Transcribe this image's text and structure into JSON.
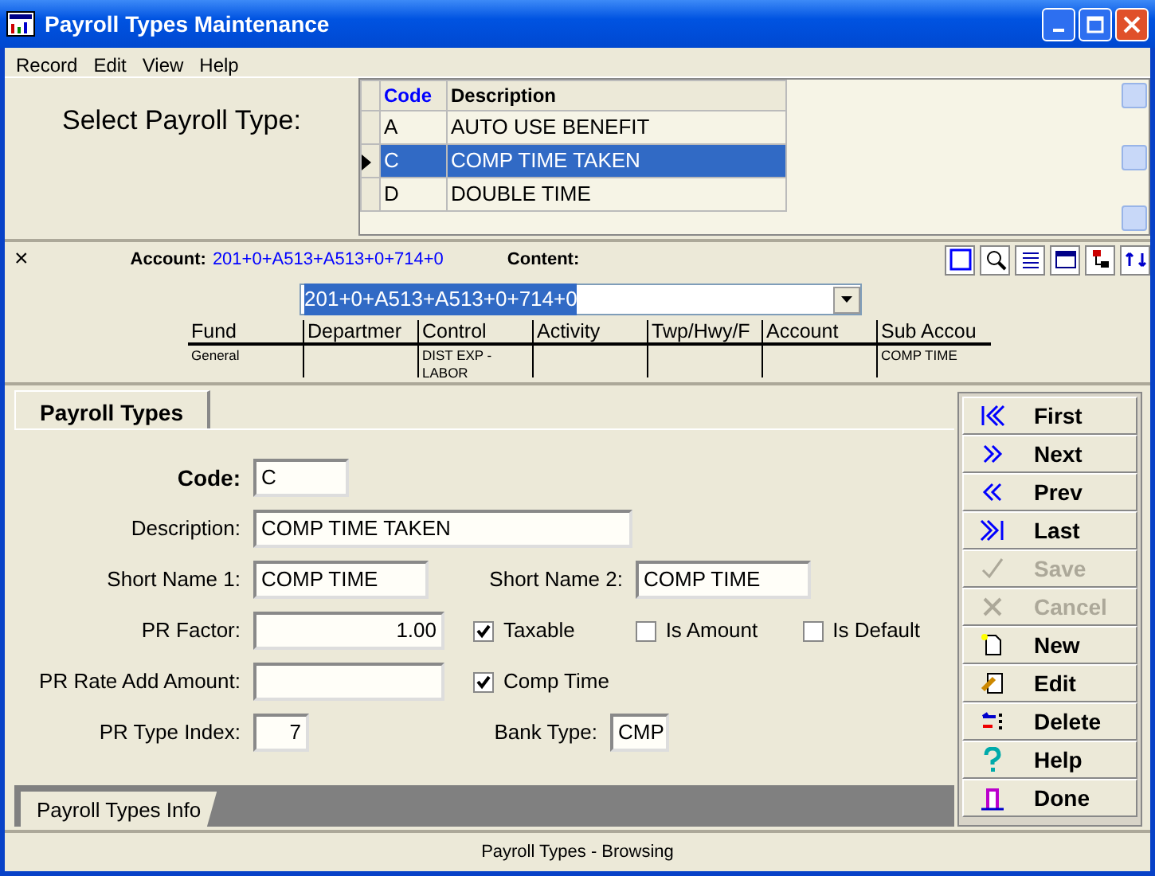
{
  "window": {
    "title": "Payroll Types Maintenance"
  },
  "menu": [
    {
      "label": "Record"
    },
    {
      "label": "Edit"
    },
    {
      "label": "View"
    },
    {
      "label": "Help"
    }
  ],
  "selector": {
    "label": "Select Payroll Type:",
    "columns": [
      {
        "label": "Code"
      },
      {
        "label": "Description"
      }
    ],
    "rows": [
      {
        "code": "A",
        "description": "AUTO USE BENEFIT",
        "selected": false
      },
      {
        "code": "C",
        "description": "COMP TIME TAKEN",
        "selected": true
      },
      {
        "code": "D",
        "description": "DOUBLE TIME",
        "selected": false
      }
    ]
  },
  "account_bar": {
    "close": "×",
    "account_label": "Account:",
    "account_value": "201+0+A513+A513+0+714+0",
    "content_label": "Content:"
  },
  "account_editor": {
    "value": "201+0+A513+A513+0+714+0",
    "segments": [
      {
        "heading": "Fund",
        "content": "General"
      },
      {
        "heading": "Departmer"
      },
      {
        "heading": "Control",
        "content": "DIST EXP - LABOR"
      },
      {
        "heading": "Activity"
      },
      {
        "heading": "Twp/Hwy/F"
      },
      {
        "heading": "Account"
      },
      {
        "heading": "Sub Accou",
        "content": "COMP TIME"
      }
    ]
  },
  "tabs": [
    {
      "label": "Payroll Types",
      "selected": true
    }
  ],
  "form": [
    [
      {
        "kind": "key",
        "label": "Code:",
        "value": "C"
      }
    ],
    [
      {
        "kind": "text",
        "label": "Description:",
        "value": "COMP TIME TAKEN"
      }
    ],
    [
      {
        "kind": "text",
        "label": "Short Name 1:",
        "value": "COMP TIME"
      },
      {
        "kind": "text",
        "label": "Short Name 2:",
        "value": "COMP TIME"
      }
    ],
    [
      {
        "kind": "number",
        "label": "PR Factor:",
        "value": "1.00"
      },
      {
        "kind": "checkbox",
        "label": "Taxable",
        "checked": true
      },
      {
        "kind": "checkbox",
        "label": "Is Amount",
        "checked": false
      },
      {
        "kind": "checkbox",
        "label": "Is Default",
        "checked": false
      }
    ],
    [
      {
        "kind": "number",
        "label": "PR Rate Add Amount:"
      },
      {
        "kind": "checkbox",
        "label": "Comp Time",
        "checked": true
      }
    ],
    [
      {
        "kind": "number",
        "label": "PR Type Index:",
        "value": "7"
      },
      {
        "kind": "text",
        "label": "Bank Type:",
        "value": "CMP"
      }
    ]
  ],
  "bottom_tabs": [
    {
      "label": "Payroll Types Info",
      "selected": true
    }
  ],
  "buttons": [
    {
      "label": "First",
      "disabled": false
    },
    {
      "label": "Next",
      "disabled": false
    },
    {
      "label": "Prev",
      "disabled": false
    },
    {
      "label": "Last",
      "disabled": false
    },
    {
      "label": "Save",
      "disabled": true
    },
    {
      "label": "Cancel",
      "disabled": true
    },
    {
      "label": "New",
      "disabled": false
    },
    {
      "label": "Edit",
      "disabled": false
    },
    {
      "label": "Delete",
      "disabled": false
    },
    {
      "label": "Help",
      "disabled": false
    },
    {
      "label": "Done",
      "disabled": false
    }
  ],
  "status_bar": "Payroll Types - Browsing"
}
